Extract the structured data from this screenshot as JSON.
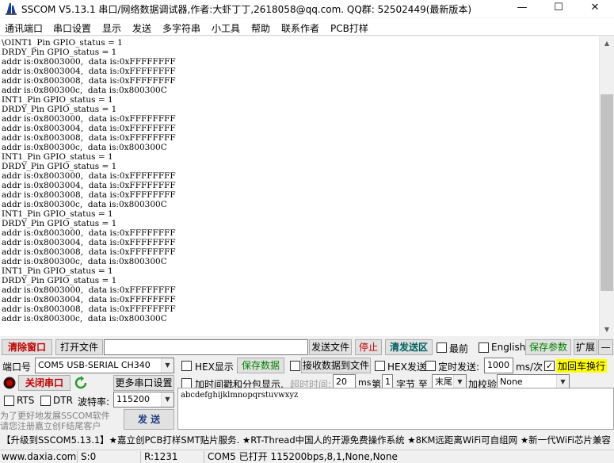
{
  "window": {
    "title": "SSCOM V5.13.1 串口/网络数据调试器,作者:大虾丁丁,2618058@qq.com. QQ群: 52502449(最新版本)",
    "minimize": "—",
    "maximize": "☐",
    "close": "✕"
  },
  "menu": [
    "通讯端口",
    "串口设置",
    "显示",
    "发送",
    "多字符串",
    "小工具",
    "帮助",
    "联系作者",
    "PCB打样"
  ],
  "terminal": {
    "lines": [
      "\\OINT1_Pin GPIO_status = 1",
      "DRDY_Pin GPIO_status = 1",
      "addr is:0x8003000,  data is:0xFFFFFFFF",
      "addr is:0x8003004,  data is:0xFFFFFFFF",
      "addr is:0x8003008,  data is:0xFFFFFFFF",
      "addr is:0x800300c,  data is:0x800300C",
      "INT1_Pin GPIO_status = 1",
      "DRDY_Pin GPIO_status = 1",
      "addr is:0x8003000,  data is:0xFFFFFFFF",
      "addr is:0x8003004,  data is:0xFFFFFFFF",
      "addr is:0x8003008,  data is:0xFFFFFFFF",
      "addr is:0x800300c,  data is:0x800300C",
      "INT1_Pin GPIO_status = 1",
      "DRDY_Pin GPIO_status = 1",
      "addr is:0x8003000,  data is:0xFFFFFFFF",
      "addr is:0x8003004,  data is:0xFFFFFFFF",
      "addr is:0x8003008,  data is:0xFFFFFFFF",
      "addr is:0x800300c,  data is:0x800300C",
      "INT1_Pin GPIO_status = 1",
      "DRDY_Pin GPIO_status = 1",
      "addr is:0x8003000,  data is:0xFFFFFFFF",
      "addr is:0x8003004,  data is:0xFFFFFFFF",
      "addr is:0x8003008,  data is:0xFFFFFFFF",
      "addr is:0x800300c,  data is:0x800300C",
      "INT1_Pin GPIO_status = 1",
      "DRDY_Pin GPIO_status = 1",
      "addr is:0x8003000,  data is:0xFFFFFFFF",
      "addr is:0x8003004,  data is:0xFFFFFFFF",
      "addr is:0x8003008,  data is:0xFFFFFFFF",
      "addr is:0x800300c,  data is:0x800300C"
    ]
  },
  "toolbar": {
    "clear_window": "清除窗口",
    "open_file": "打开文件",
    "file_path": "",
    "send_file": "发送文件",
    "stop": "停止",
    "clear_send": "清发送区",
    "topmost": "最前",
    "english": "English",
    "save_params": "保存参数",
    "expand": "扩展",
    "collapse": "—"
  },
  "port": {
    "label": "端口号",
    "value": "COM5 USB-SERIAL CH340",
    "close_port": "关闭串口",
    "more_settings": "更多串口设置",
    "rts": "RTS",
    "dtr": "DTR",
    "baud_label": "波特率:",
    "baud_value": "115200"
  },
  "options": {
    "hex_display": "HEX显示",
    "save_data": "保存数据",
    "recv_to_file": "接收数据到文件",
    "hex_send": "HEX发送",
    "timed_send": "定时发送:",
    "interval_value": "1000",
    "interval_unit": "ms/次",
    "add_crlf": "加回车换行",
    "add_timestamp": "加时间戳和分包显示,",
    "timeout_label": "超时时间:",
    "timeout_value": "20",
    "timeout_unit": "ms",
    "byte_pre": "第",
    "byte_index": "1",
    "byte_mid": "字节 至",
    "byte_end": "末尾",
    "checksum_label": "加校验",
    "checksum_value": "None"
  },
  "promo": {
    "line1": "为了更好地发展SSCOM软件",
    "line2": "请您注册嘉立创F结尾客户",
    "send_button": "发 送"
  },
  "send_area": {
    "text": "abcdefghijklmnopqrstuvwxyz"
  },
  "ticker": {
    "text": "【升级到SSCOM5.13.1】★嘉立创PCB打样SMT贴片服务. ★RT-Thread中国人的开源免费操作系统 ★8KM远距离WiFi可自组网 ★新一代WiFi芯片兼容"
  },
  "statusbar": {
    "website": "www.daxia.com",
    "sent": "S:0",
    "received": "R:1231",
    "port_status": "COM5 已打开  115200bps,8,1,None,None"
  },
  "colors": {
    "clear_window_text": "#c00000",
    "stop_text": "#c00000",
    "clear_send_text": "#006060",
    "save_data_text": "#008000",
    "save_params_text": "#008000",
    "crlf_highlight": "#ffff00",
    "promo_text": "#808080"
  }
}
